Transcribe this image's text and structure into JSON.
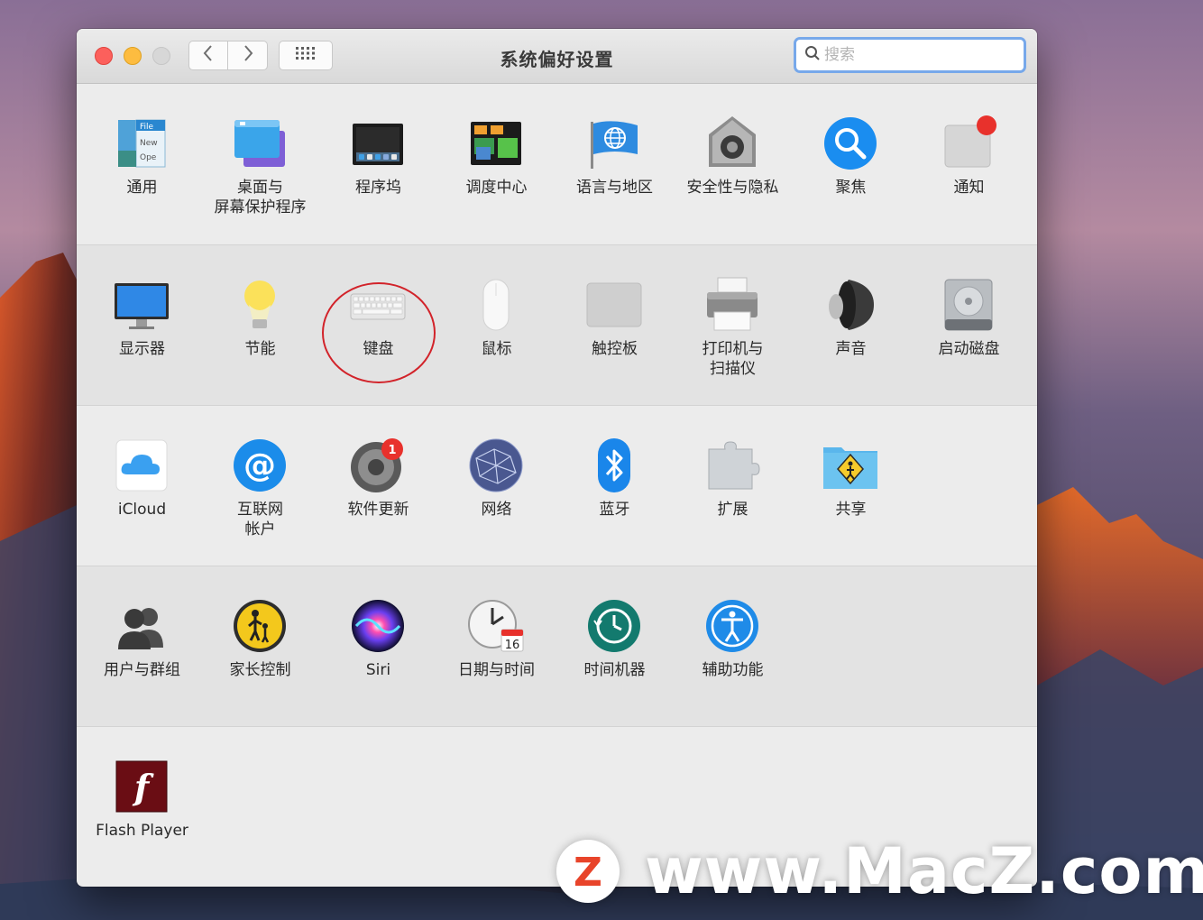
{
  "window": {
    "title": "系统偏好设置",
    "search_placeholder": "搜索",
    "search_value": ""
  },
  "toolbar": {
    "back_glyph": "‹",
    "forward_glyph": "›"
  },
  "rows": [
    [
      {
        "label": "通用",
        "icon": "general-icon"
      },
      {
        "label": "桌面与\n屏幕保护程序",
        "icon": "desktop-screensaver-icon"
      },
      {
        "label": "程序坞",
        "icon": "dock-icon"
      },
      {
        "label": "调度中心",
        "icon": "mission-control-icon"
      },
      {
        "label": "语言与地区",
        "icon": "language-region-icon"
      },
      {
        "label": "安全性与隐私",
        "icon": "security-privacy-icon"
      },
      {
        "label": "聚焦",
        "icon": "spotlight-icon"
      },
      {
        "label": "通知",
        "icon": "notifications-icon"
      }
    ],
    [
      {
        "label": "显示器",
        "icon": "displays-icon"
      },
      {
        "label": "节能",
        "icon": "energy-saver-icon"
      },
      {
        "label": "键盘",
        "icon": "keyboard-icon"
      },
      {
        "label": "鼠标",
        "icon": "mouse-icon"
      },
      {
        "label": "触控板",
        "icon": "trackpad-icon"
      },
      {
        "label": "打印机与\n扫描仪",
        "icon": "printer-scanner-icon"
      },
      {
        "label": "声音",
        "icon": "sound-icon"
      },
      {
        "label": "启动磁盘",
        "icon": "startup-disk-icon"
      }
    ],
    [
      {
        "label": "iCloud",
        "icon": "icloud-icon"
      },
      {
        "label": "互联网\n帐户",
        "icon": "internet-accounts-icon"
      },
      {
        "label": "软件更新",
        "icon": "software-update-icon",
        "badge": "1"
      },
      {
        "label": "网络",
        "icon": "network-icon"
      },
      {
        "label": "蓝牙",
        "icon": "bluetooth-icon"
      },
      {
        "label": "扩展",
        "icon": "extensions-icon"
      },
      {
        "label": "共享",
        "icon": "sharing-icon"
      }
    ],
    [
      {
        "label": "用户与群组",
        "icon": "users-groups-icon"
      },
      {
        "label": "家长控制",
        "icon": "parental-controls-icon"
      },
      {
        "label": "Siri",
        "icon": "siri-icon"
      },
      {
        "label": "日期与时间",
        "icon": "date-time-icon",
        "date": "16"
      },
      {
        "label": "时间机器",
        "icon": "time-machine-icon"
      },
      {
        "label": "辅助功能",
        "icon": "accessibility-icon"
      }
    ],
    [
      {
        "label": "Flash Player",
        "icon": "flash-player-icon"
      }
    ]
  ],
  "watermark": {
    "logo_letter": "Z",
    "text": "www.MacZ.com"
  },
  "colors": {
    "accent": "#77a8ea",
    "highlight_circle": "#d2232a",
    "badge": "#e8312c"
  }
}
